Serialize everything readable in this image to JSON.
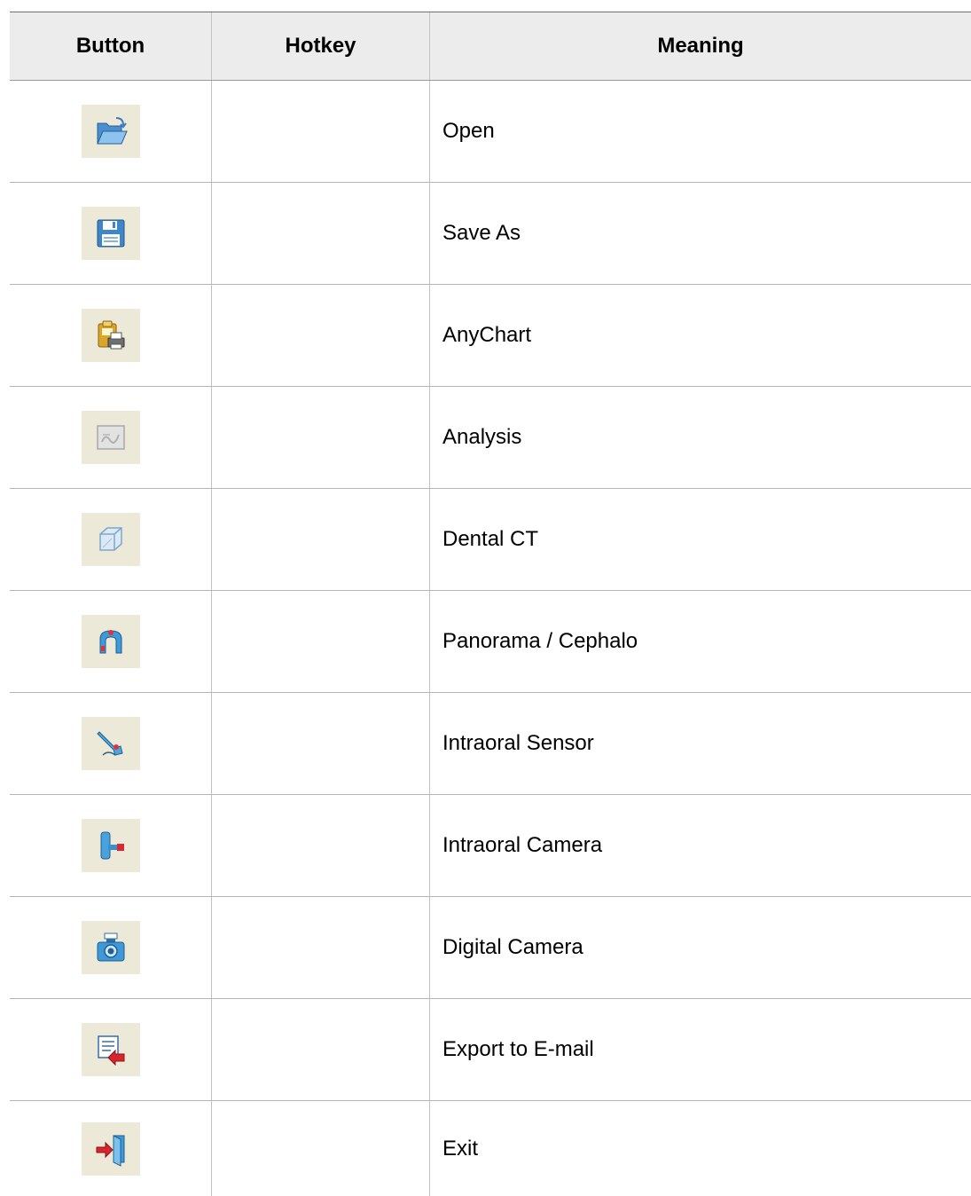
{
  "table": {
    "headers": {
      "button": "Button",
      "hotkey": "Hotkey",
      "meaning": "Meaning"
    },
    "rows": [
      {
        "icon": "open-folder-icon",
        "hotkey": "",
        "meaning": "Open"
      },
      {
        "icon": "floppy-disk-icon",
        "hotkey": "",
        "meaning": "Save As"
      },
      {
        "icon": "clipboard-printer-icon",
        "hotkey": "",
        "meaning": "AnyChart"
      },
      {
        "icon": "analysis-icon",
        "hotkey": "",
        "meaning": "Analysis"
      },
      {
        "icon": "cube-icon",
        "hotkey": "",
        "meaning": "Dental CT"
      },
      {
        "icon": "panorama-device-icon",
        "hotkey": "",
        "meaning": "Panorama / Cephalo"
      },
      {
        "icon": "intraoral-sensor-icon",
        "hotkey": "",
        "meaning": "Intraoral Sensor"
      },
      {
        "icon": "intraoral-camera-icon",
        "hotkey": "",
        "meaning": "Intraoral Camera"
      },
      {
        "icon": "digital-camera-icon",
        "hotkey": "",
        "meaning": "Digital Camera"
      },
      {
        "icon": "export-email-icon",
        "hotkey": "",
        "meaning": "Export to E-mail"
      },
      {
        "icon": "exit-door-icon",
        "hotkey": "",
        "meaning": "Exit"
      }
    ]
  }
}
